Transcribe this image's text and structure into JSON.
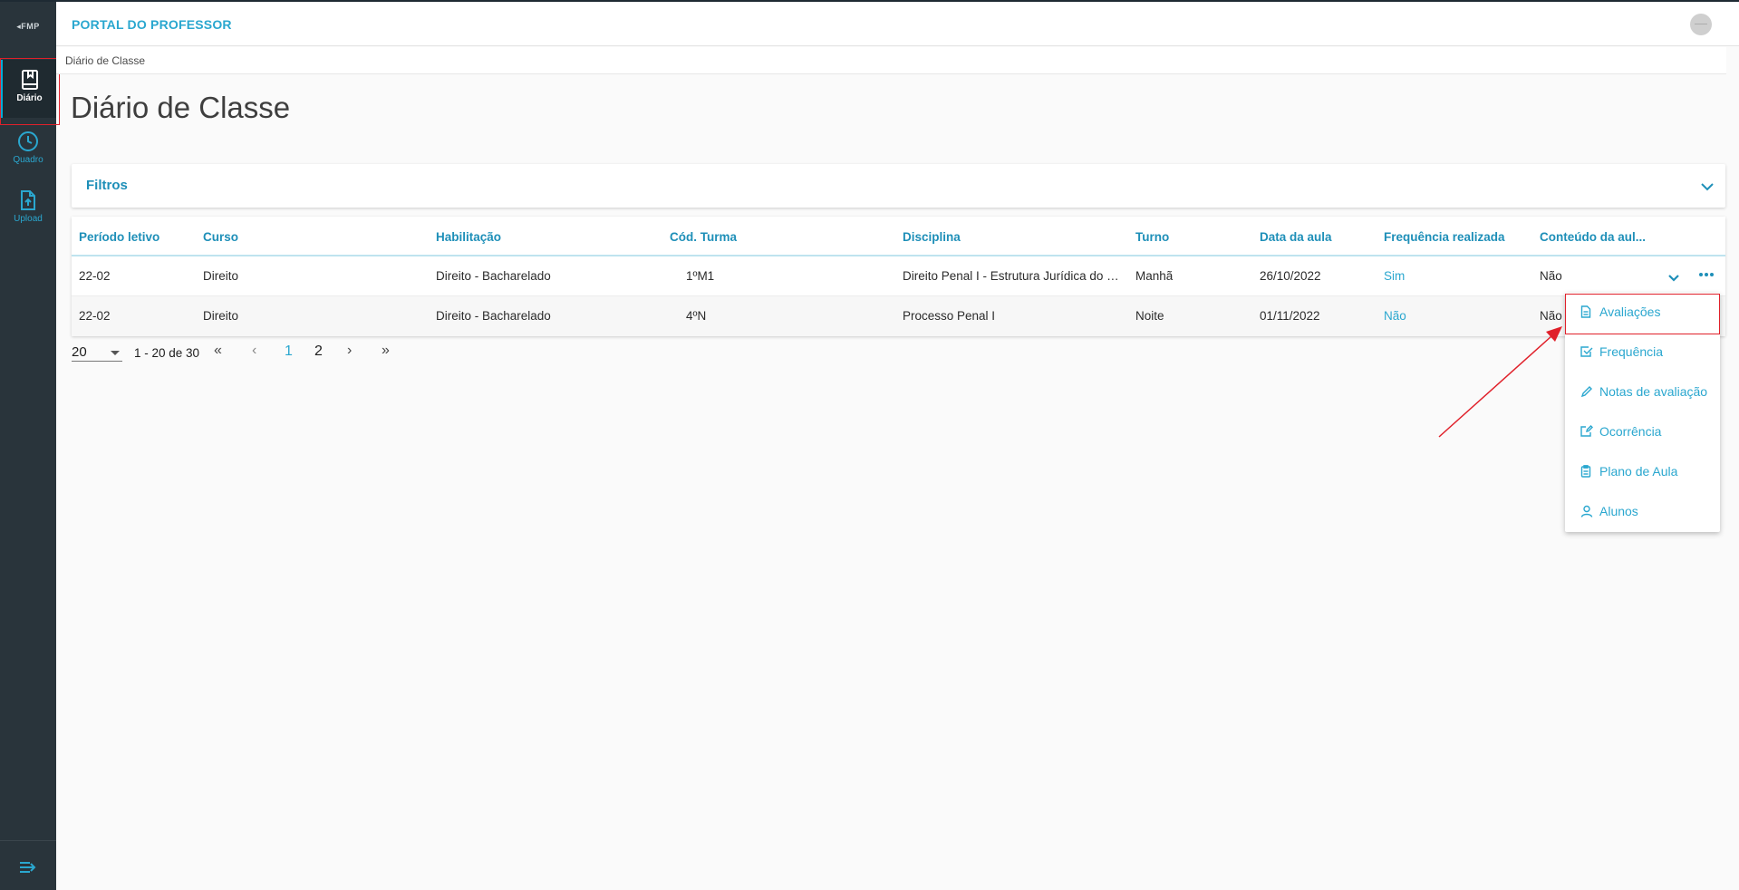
{
  "app": {
    "logo_text": "◂FMP",
    "title": "PORTAL DO PROFESSOR",
    "avatar_text": "——"
  },
  "sidebar": {
    "items": [
      {
        "label": "Diário",
        "icon": "book-icon",
        "active": true
      },
      {
        "label": "Quadro",
        "icon": "clock-icon"
      },
      {
        "label": "Upload",
        "icon": "file-upload-icon"
      }
    ],
    "collapse_icon": "menu-collapse-icon"
  },
  "breadcrumb": "Diário de Classe",
  "page_title": "Diário de Classe",
  "filters": {
    "title": "Filtros"
  },
  "table": {
    "columns": [
      "Período letivo",
      "Curso",
      "Habilitação",
      "Cód. Turma",
      "Disciplina",
      "Turno",
      "Data da aula",
      "Frequência realizada",
      "Conteúdo da aul..."
    ],
    "rows": [
      [
        "22-02",
        "Direito",
        "Direito - Bacharelado",
        "1ºM1",
        "Direito Penal I - Estrutura Jurídica do Crime",
        "Manhã",
        "26/10/2022",
        "Sim",
        "Não"
      ],
      [
        "22-02",
        "Direito",
        "Direito - Bacharelado",
        "4ºN",
        "Processo Penal I",
        "Noite",
        "01/11/2022",
        "Não",
        "Não"
      ]
    ]
  },
  "pagination": {
    "page_size": "20",
    "range": "1 - 20 de 30",
    "first": "«",
    "prev": "‹",
    "pages": [
      "1",
      "2"
    ],
    "next": "›",
    "last": "»"
  },
  "row_menu": {
    "items": [
      {
        "label": "Avaliações",
        "icon": "document-icon"
      },
      {
        "label": "Frequência",
        "icon": "checkbox-icon"
      },
      {
        "label": "Notas de avaliação",
        "icon": "pencil-icon"
      },
      {
        "label": "Ocorrência",
        "icon": "note-edit-icon"
      },
      {
        "label": "Plano de Aula",
        "icon": "clipboard-icon"
      },
      {
        "label": "Alunos",
        "icon": "user-icon"
      }
    ]
  },
  "colors": {
    "accent": "#2aa7cf",
    "sidebar_bg": "#29343b",
    "annotation": "#e0202a"
  }
}
